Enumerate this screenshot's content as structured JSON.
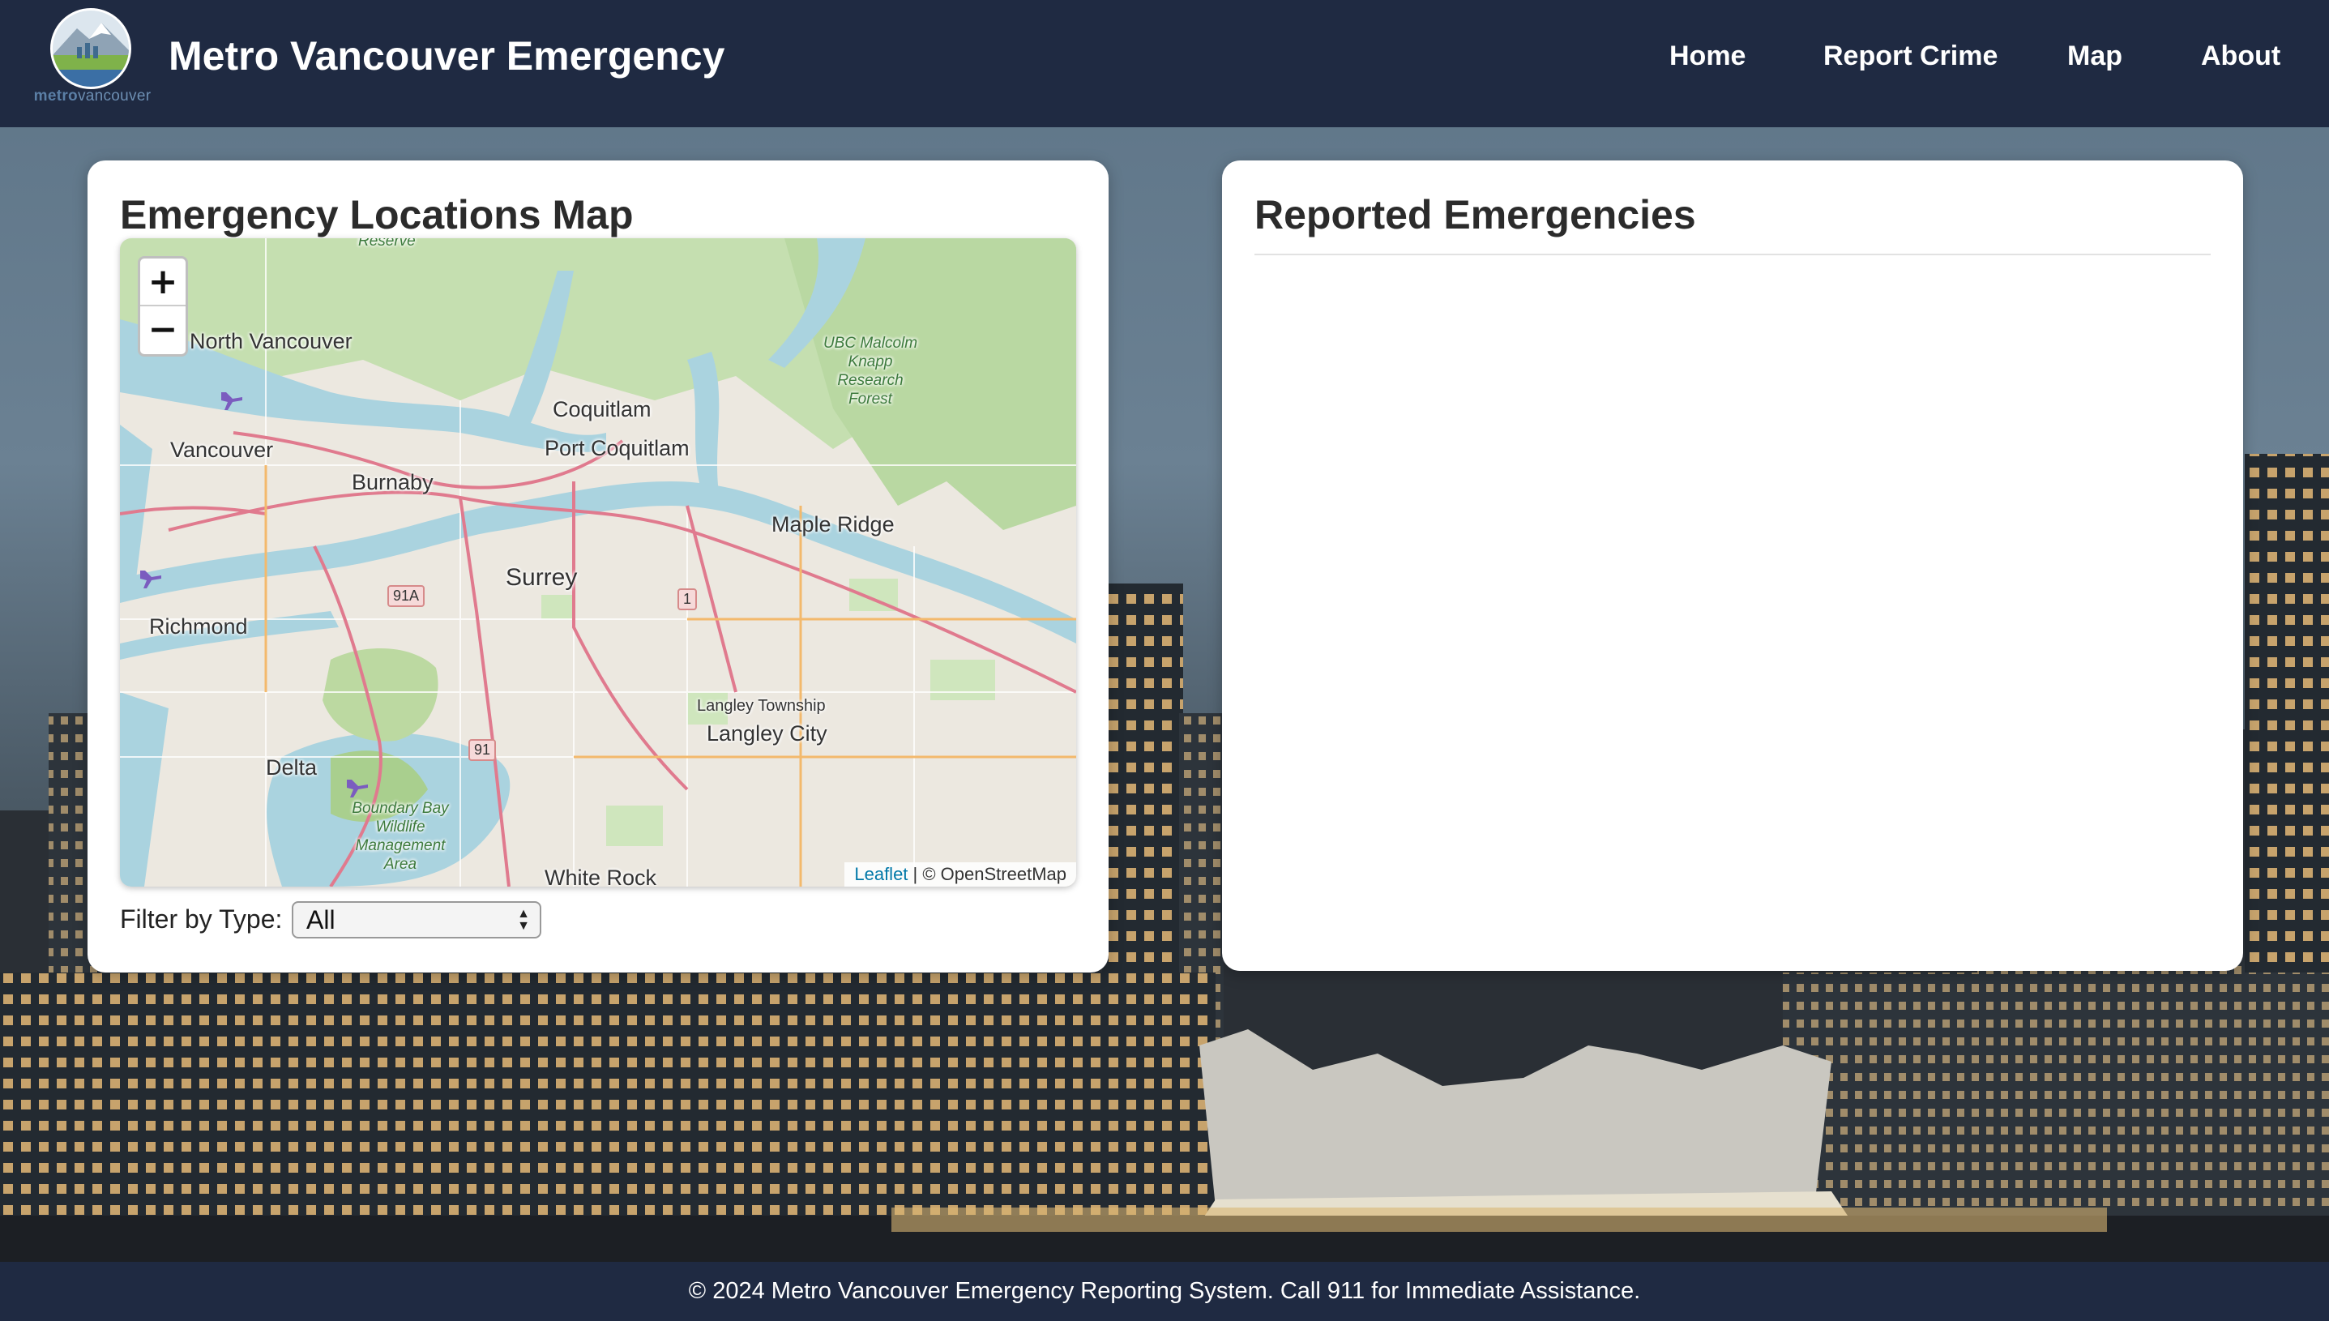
{
  "header": {
    "logo_word_bold": "metro",
    "logo_word_rest": "vancouver",
    "title": "Metro Vancouver Emergency",
    "nav": [
      {
        "label": "Home"
      },
      {
        "label": "Report Crime"
      },
      {
        "label": "Map"
      },
      {
        "label": "About"
      }
    ]
  },
  "map_panel": {
    "heading": "Emergency Locations Map",
    "zoom_in": "+",
    "zoom_out": "−",
    "labels": {
      "north_vancouver": "North Vancouver",
      "vancouver": "Vancouver",
      "burnaby": "Burnaby",
      "coquitlam": "Coquitlam",
      "port_coquitlam": "Port Coquitlam",
      "maple_ridge": "Maple Ridge",
      "surrey": "Surrey",
      "richmond": "Richmond",
      "delta": "Delta",
      "langley_township": "Langley Township",
      "langley_city": "Langley City",
      "white_rock": "White Rock",
      "ubc_forest": "UBC Malcolm Knapp Research Forest",
      "boundary_bay": "Boundary Bay Wildlife Management Area",
      "reserve": "Reserve"
    },
    "shields": {
      "hwy_91a": "91A",
      "hwy_1": "1",
      "hwy_91": "91"
    },
    "attribution_leaflet": "Leaflet",
    "attribution_rest": " | © OpenStreetMap",
    "filter_label": "Filter by Type:",
    "filter_value": "All"
  },
  "list_panel": {
    "heading": "Reported Emergencies"
  },
  "footer": {
    "text": "© 2024 Metro Vancouver Emergency Reporting System. Call 911 for Immediate Assistance."
  },
  "colors": {
    "header_bg": "#1f2a42",
    "map_water": "#aad3df",
    "map_park": "#c8e1b4",
    "map_road": "#e07a8e"
  },
  "icons": [
    "airport-icon"
  ]
}
